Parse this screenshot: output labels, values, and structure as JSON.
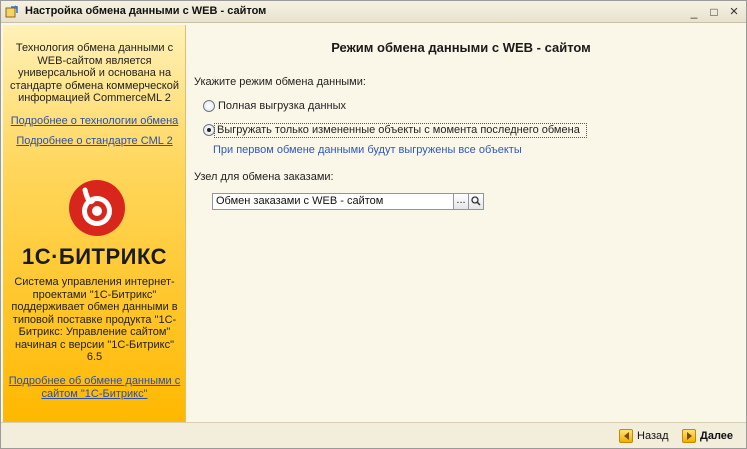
{
  "window": {
    "title": "Настройка обмена данными с WEB - сайтом",
    "minimize": "_",
    "maximize": "□",
    "close": "×"
  },
  "sidebar": {
    "intro": "Технология обмена данными с WEB-сайтом является универсальной и основана на стандарте обмена коммерческой информацией CommerceML 2",
    "link_technology": "Подробнее о технологии обмена",
    "link_standard": "Подробнее о стандарте CML 2",
    "logo_text": "1С·БИТРИКС",
    "description": "Система управления интернет-проектами \"1С-Битрикс\" поддерживает обмен данными в типовой поставке продукта \"1С-Битрикс: Управление сайтом\" начиная с версии \"1С-Битрикс\" 6.5",
    "link_exchange": "Подробнее об обмене данными с сайтом \"1С-Битрикс\"",
    "gradient_top": "#fff1b8",
    "gradient_bottom": "#ffb800",
    "link_color": "#2b4fa8"
  },
  "main": {
    "heading": "Режим обмена данными с WEB - сайтом",
    "mode_prompt": "Укажите режим обмена данными:",
    "options": [
      {
        "label": "Полная выгрузка данных",
        "selected": false
      },
      {
        "label": "Выгружать только измененные объекты с момента последнего обмена",
        "selected": true
      }
    ],
    "note": "При первом обмене данными будут выгружены все объекты",
    "node_label": "Узел для обмена заказами:",
    "node_value": "Обмен заказами с WEB - сайтом",
    "select_button": "...",
    "note_color": "#2f58b8"
  },
  "footer": {
    "back_label": "Назад",
    "next_label": "Далее"
  }
}
